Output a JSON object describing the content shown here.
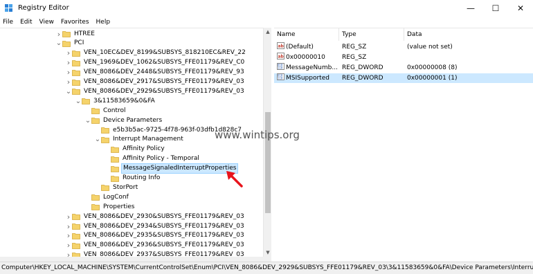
{
  "window": {
    "title": "Registry Editor",
    "minimize": "—",
    "maximize": "☐",
    "close": "✕"
  },
  "menu": [
    "File",
    "Edit",
    "View",
    "Favorites",
    "Help"
  ],
  "tree": [
    {
      "label": "HTREE",
      "depth": 0,
      "chevron": ">"
    },
    {
      "label": "PCI",
      "depth": 0,
      "chevron": "v"
    },
    {
      "label": "VEN_10EC&DEV_8199&SUBSYS_818210EC&REV_22",
      "depth": 1,
      "chevron": ">"
    },
    {
      "label": "VEN_1969&DEV_1062&SUBSYS_FFE01179&REV_C0",
      "depth": 1,
      "chevron": ">"
    },
    {
      "label": "VEN_8086&DEV_2448&SUBSYS_FFE01179&REV_93",
      "depth": 1,
      "chevron": ">"
    },
    {
      "label": "VEN_8086&DEV_2917&SUBSYS_FFE01179&REV_03",
      "depth": 1,
      "chevron": ">"
    },
    {
      "label": "VEN_8086&DEV_2929&SUBSYS_FFE01179&REV_03",
      "depth": 1,
      "chevron": "v"
    },
    {
      "label": "3&11583659&0&FA",
      "depth": 2,
      "chevron": "v"
    },
    {
      "label": "Control",
      "depth": 3,
      "chevron": ""
    },
    {
      "label": "Device Parameters",
      "depth": 3,
      "chevron": "v"
    },
    {
      "label": "e5b3b5ac-9725-4f78-963f-03dfb1d828c7",
      "depth": 4,
      "chevron": ""
    },
    {
      "label": "Interrupt Management",
      "depth": 4,
      "chevron": "v"
    },
    {
      "label": "Affinity Policy",
      "depth": 5,
      "chevron": ""
    },
    {
      "label": "Affinity Policy - Temporal",
      "depth": 5,
      "chevron": ""
    },
    {
      "label": "MessageSignaledInterruptProperties",
      "depth": 5,
      "chevron": "",
      "selected": true
    },
    {
      "label": "Routing Info",
      "depth": 5,
      "chevron": ""
    },
    {
      "label": "StorPort",
      "depth": 4,
      "chevron": ""
    },
    {
      "label": "LogConf",
      "depth": 3,
      "chevron": ""
    },
    {
      "label": "Properties",
      "depth": 3,
      "chevron": ""
    },
    {
      "label": "VEN_8086&DEV_2930&SUBSYS_FFE01179&REV_03",
      "depth": 1,
      "chevron": ">"
    },
    {
      "label": "VEN_8086&DEV_2934&SUBSYS_FFE01179&REV_03",
      "depth": 1,
      "chevron": ">"
    },
    {
      "label": "VEN_8086&DEV_2935&SUBSYS_FFE01179&REV_03",
      "depth": 1,
      "chevron": ">"
    },
    {
      "label": "VEN_8086&DEV_2936&SUBSYS_FFE01179&REV_03",
      "depth": 1,
      "chevron": ">"
    },
    {
      "label": "VEN_8086&DEV_2937&SUBSYS_FFE01179&REV_03",
      "depth": 1,
      "chevron": ">"
    }
  ],
  "list": {
    "columns": [
      "Name",
      "Type",
      "Data"
    ],
    "rows": [
      {
        "name": "(Default)",
        "type": "REG_SZ",
        "data": "(value not set)",
        "icon": "string-value-icon"
      },
      {
        "name": "0x00000010",
        "type": "REG_SZ",
        "data": "",
        "icon": "string-value-icon"
      },
      {
        "name": "MessageNumb...",
        "type": "REG_DWORD",
        "data": "0x00000008 (8)",
        "icon": "binary-value-icon"
      },
      {
        "name": "MSISupported",
        "type": "REG_DWORD",
        "data": "0x00000001 (1)",
        "icon": "binary-value-icon",
        "selected": true
      }
    ]
  },
  "status_path": "Computer\\HKEY_LOCAL_MACHINE\\SYSTEM\\CurrentControlSet\\Enum\\PCI\\VEN_8086&DEV_2929&SUBSYS_FFE01179&REV_03\\3&11583659&0&FA\\Device Parameters\\Interrupt Managemer",
  "watermark": "www.wintips.org",
  "colors": {
    "selection": "#cce8ff",
    "folder": "#f5d36b",
    "arrow": "#e8141c"
  }
}
